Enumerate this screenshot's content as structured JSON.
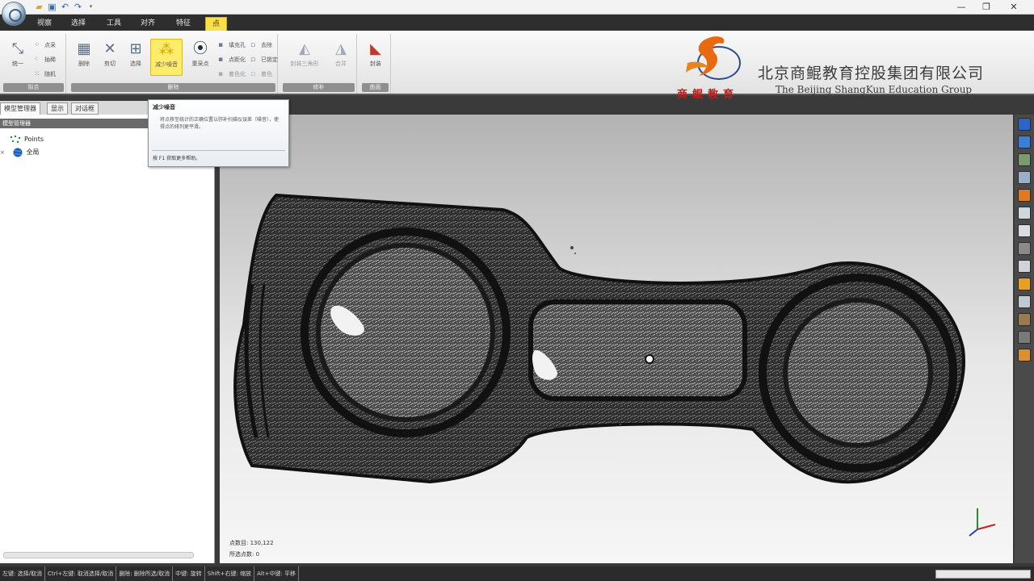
{
  "title_bar": {
    "quick_access": [
      "folder-icon",
      "save-icon",
      "undo-icon",
      "redo-icon",
      "dropdown-icon"
    ],
    "controls": {
      "minimize": "—",
      "maximize": "❐",
      "close": "✕"
    }
  },
  "tabs": [
    {
      "label": "视察"
    },
    {
      "label": "选择"
    },
    {
      "label": "工具"
    },
    {
      "label": "对齐"
    },
    {
      "label": "特征"
    },
    {
      "label": "点"
    }
  ],
  "ribbon": {
    "group1": {
      "label": "拟合",
      "big": {
        "label": "统一",
        "icon": "unify-icon"
      },
      "small": [
        {
          "label": "点采",
          "icon": "points-icon"
        },
        {
          "label": "抽稀",
          "icon": "thin-icon"
        },
        {
          "label": "随机",
          "icon": "random-icon"
        }
      ]
    },
    "group2": {
      "label": "删除",
      "buttons": [
        {
          "label": "删除",
          "icon": "delete-grid-icon"
        },
        {
          "label": "剪切",
          "icon": "cut-icon"
        },
        {
          "label": "选择",
          "icon": "select-grid-icon"
        },
        {
          "label": "减少噪音",
          "icon": "reduce-noise-icon",
          "highlight": true
        },
        {
          "label": "重采点",
          "icon": "resample-icon"
        }
      ],
      "small": [
        {
          "label": "填充孔",
          "icon": "fill-icon"
        },
        {
          "label": "去除",
          "icon": "remove-icon"
        },
        {
          "label": "点距化",
          "icon": "spacing-icon"
        },
        {
          "label": "已锁定",
          "icon": "lock-icon"
        },
        {
          "label": "着色化",
          "icon": "shade-icon"
        },
        {
          "label": "着色",
          "icon": "color-icon"
        }
      ]
    },
    "group3": {
      "label": "修补",
      "buttons": [
        {
          "label": "封装三角形",
          "icon": "wrap-icon"
        },
        {
          "label": "合并",
          "icon": "merge-icon"
        }
      ]
    },
    "group4": {
      "label": "曲面",
      "buttons": [
        {
          "label": "封装",
          "icon": "wrap-surface-icon"
        }
      ]
    }
  },
  "logo": {
    "cn": "北京商鲲教育控股集团有限公司",
    "en": "The Beijing ShangKun Education Group",
    "sub": "商鲲教育"
  },
  "tooltip": {
    "title": "减少噪音",
    "desc": "将点移至统计的正确位置以弥补扫描仪误差（噪音），使得点的排列更平滑。",
    "help": "按 F1 获取更多帮助。"
  },
  "left_tabs": [
    {
      "label": "模型管理器"
    },
    {
      "label": "显示"
    },
    {
      "label": "对话框"
    }
  ],
  "model_manager": {
    "header": "模型管理器",
    "items": [
      {
        "label": "Points",
        "icon": "points-node-icon"
      },
      {
        "label": "全局",
        "icon": "globe-icon"
      }
    ]
  },
  "viewport": {
    "stat_points": "点数目: 130,122",
    "stat_selected": "所选点数: 0"
  },
  "right_toolbar": {
    "colors": [
      "#2a66c8",
      "#3b7fd8",
      "#7a9a70",
      "#9ab0c8",
      "#e07a20",
      "#cfd6de",
      "#d8dde4",
      "#8a8a8a",
      "#d0d4d8",
      "#e8a020",
      "#c0c8d2",
      "#9a7a50",
      "#7a7a7a",
      "#d89030"
    ]
  },
  "status_bar": {
    "segments": [
      "左键: 选择/取消",
      "Ctrl+左键: 取消选择/取消",
      "删除: 删除所选/取消",
      "中键: 旋转",
      "Shift+右键: 缩放",
      "Alt+中键: 平移"
    ]
  }
}
